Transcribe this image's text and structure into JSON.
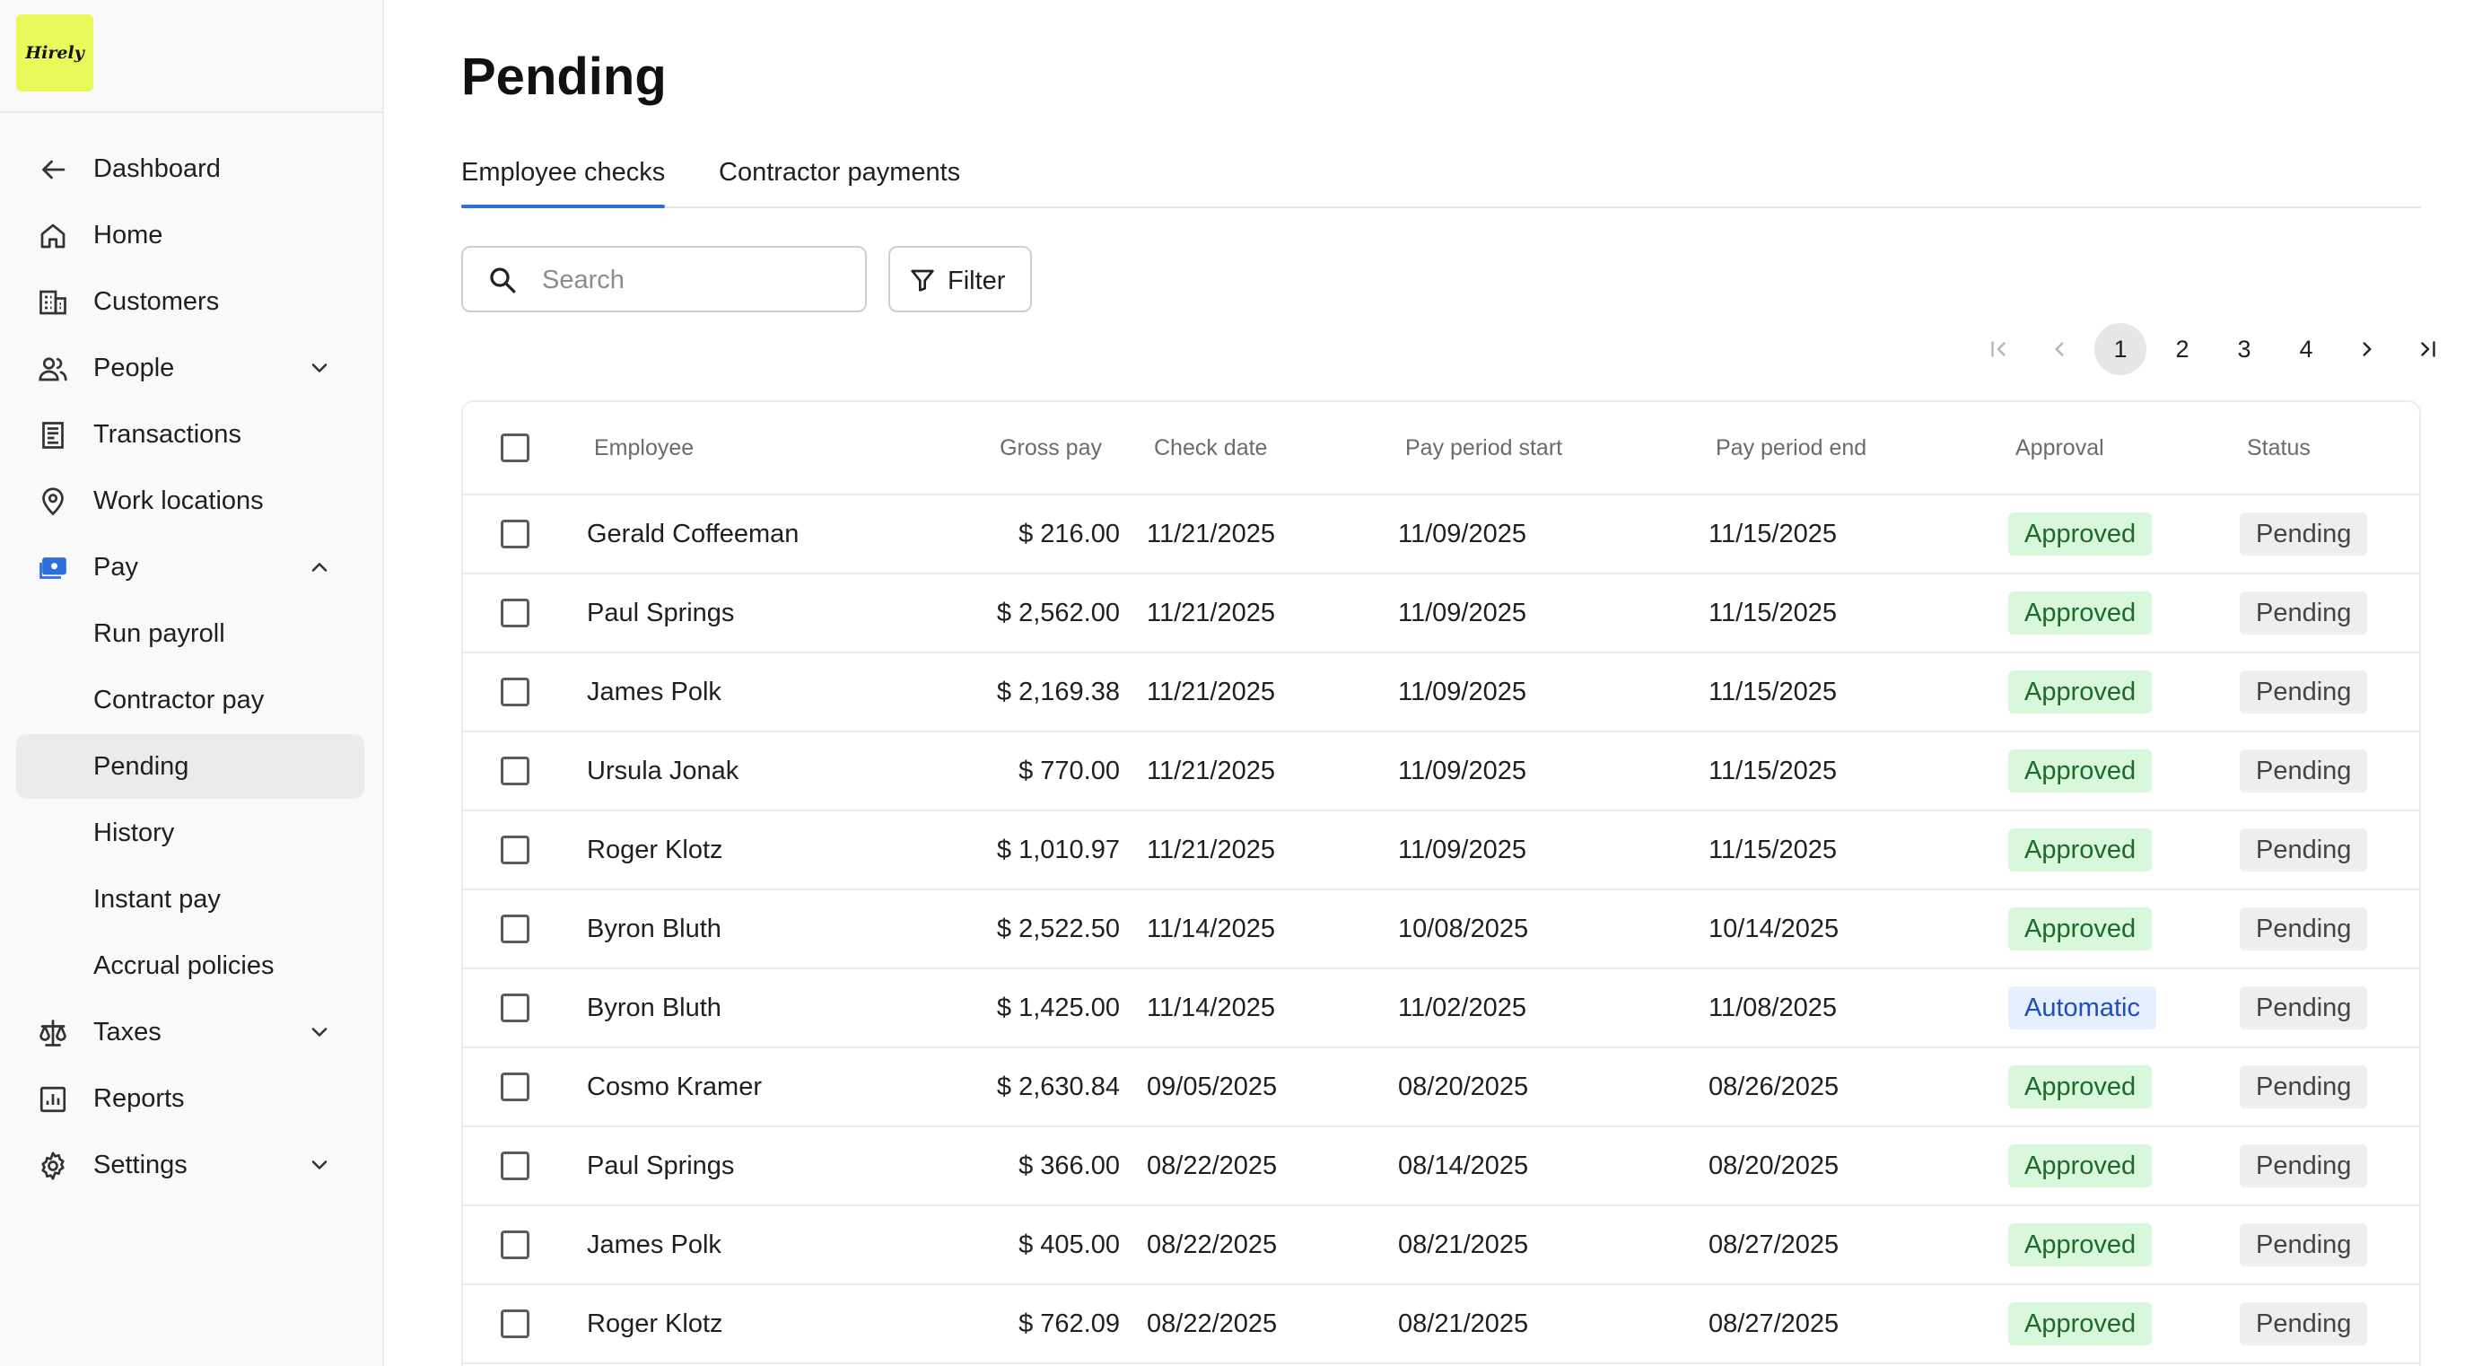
{
  "logo": {
    "text": "Hirely",
    "color": "#e9f95a"
  },
  "sidebar": {
    "items": [
      {
        "label": "Dashboard",
        "icon": "arrow-left-icon"
      },
      {
        "label": "Home",
        "icon": "home-icon"
      },
      {
        "label": "Customers",
        "icon": "building-icon"
      },
      {
        "label": "People",
        "icon": "people-icon",
        "expandable": "collapsed"
      },
      {
        "label": "Transactions",
        "icon": "receipt-icon"
      },
      {
        "label": "Work locations",
        "icon": "location-pin-icon"
      },
      {
        "label": "Pay",
        "icon": "cash-icon",
        "expandable": "expanded"
      },
      {
        "label": "Run payroll",
        "sub": true
      },
      {
        "label": "Contractor pay",
        "sub": true
      },
      {
        "label": "Pending",
        "sub": true,
        "active": true
      },
      {
        "label": "History",
        "sub": true
      },
      {
        "label": "Instant pay",
        "sub": true
      },
      {
        "label": "Accrual policies",
        "sub": true
      },
      {
        "label": "Taxes",
        "icon": "scale-icon",
        "expandable": "collapsed"
      },
      {
        "label": "Reports",
        "icon": "chart-icon"
      },
      {
        "label": "Settings",
        "icon": "gear-icon",
        "expandable": "collapsed"
      }
    ]
  },
  "page": {
    "title": "Pending"
  },
  "tabs": [
    {
      "label": "Employee checks",
      "active": true
    },
    {
      "label": "Contractor payments",
      "active": false
    }
  ],
  "search": {
    "placeholder": "Search",
    "value": ""
  },
  "filter": {
    "label": "Filter"
  },
  "pagination": {
    "pages": [
      "1",
      "2",
      "3",
      "4"
    ],
    "current": "1"
  },
  "table": {
    "columns": {
      "employee": "Employee",
      "gross": "Gross pay",
      "check_date": "Check date",
      "start": "Pay period start",
      "end": "Pay period end",
      "approval": "Approval",
      "status": "Status"
    },
    "rows": [
      {
        "employee": "Gerald Coffeeman",
        "gross": "$ 216.00",
        "check_date": "11/21/2025",
        "start": "11/09/2025",
        "end": "11/15/2025",
        "approval": "Approved",
        "status": "Pending"
      },
      {
        "employee": "Paul Springs",
        "gross": "$ 2,562.00",
        "check_date": "11/21/2025",
        "start": "11/09/2025",
        "end": "11/15/2025",
        "approval": "Approved",
        "status": "Pending"
      },
      {
        "employee": "James Polk",
        "gross": "$ 2,169.38",
        "check_date": "11/21/2025",
        "start": "11/09/2025",
        "end": "11/15/2025",
        "approval": "Approved",
        "status": "Pending"
      },
      {
        "employee": "Ursula Jonak",
        "gross": "$ 770.00",
        "check_date": "11/21/2025",
        "start": "11/09/2025",
        "end": "11/15/2025",
        "approval": "Approved",
        "status": "Pending"
      },
      {
        "employee": "Roger Klotz",
        "gross": "$ 1,010.97",
        "check_date": "11/21/2025",
        "start": "11/09/2025",
        "end": "11/15/2025",
        "approval": "Approved",
        "status": "Pending"
      },
      {
        "employee": "Byron Bluth",
        "gross": "$ 2,522.50",
        "check_date": "11/14/2025",
        "start": "10/08/2025",
        "end": "10/14/2025",
        "approval": "Approved",
        "status": "Pending"
      },
      {
        "employee": "Byron Bluth",
        "gross": "$ 1,425.00",
        "check_date": "11/14/2025",
        "start": "11/02/2025",
        "end": "11/08/2025",
        "approval": "Automatic",
        "status": "Pending"
      },
      {
        "employee": "Cosmo Kramer",
        "gross": "$ 2,630.84",
        "check_date": "09/05/2025",
        "start": "08/20/2025",
        "end": "08/26/2025",
        "approval": "Approved",
        "status": "Pending"
      },
      {
        "employee": "Paul Springs",
        "gross": "$ 366.00",
        "check_date": "08/22/2025",
        "start": "08/14/2025",
        "end": "08/20/2025",
        "approval": "Approved",
        "status": "Pending"
      },
      {
        "employee": "James Polk",
        "gross": "$ 405.00",
        "check_date": "08/22/2025",
        "start": "08/21/2025",
        "end": "08/27/2025",
        "approval": "Approved",
        "status": "Pending"
      },
      {
        "employee": "Roger Klotz",
        "gross": "$ 762.09",
        "check_date": "08/22/2025",
        "start": "08/21/2025",
        "end": "08/27/2025",
        "approval": "Approved",
        "status": "Pending"
      }
    ]
  },
  "colors": {
    "accent": "#2f6fdc",
    "approved_bg": "#d8f7db",
    "automatic_bg": "#e6efff",
    "pending_bg": "#eeeeee"
  }
}
